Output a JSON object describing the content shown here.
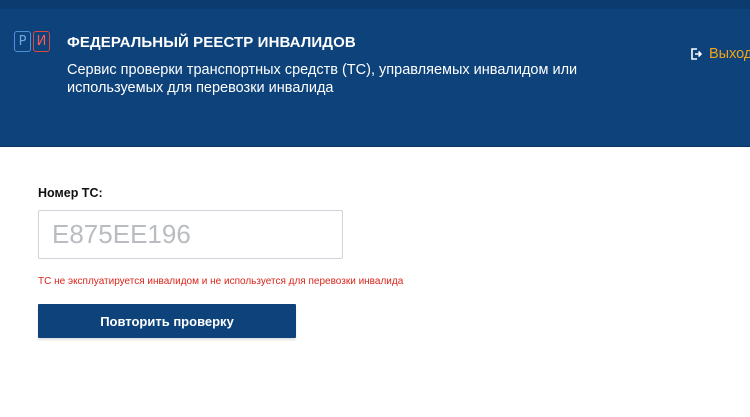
{
  "header": {
    "logo": {
      "left_letter": "Р",
      "right_letter": "И"
    },
    "title": "ФЕДЕРАЛЬНЫЙ РЕЕСТР ИНВАЛИДОВ",
    "subtitle": "Сервис проверки транспортных средств (ТС), управляемых инвалидом или используемых для перевозки инвалида",
    "logout_label": "Выход",
    "logout_icon": "logout-icon"
  },
  "form": {
    "vehicle_number_label": "Номер ТС:",
    "vehicle_number_value": "Е875ЕЕ196",
    "result_message": "ТС не эксплуатируется инвалидом и не используется для перевозки инвалида",
    "retry_button_label": "Повторить проверку"
  },
  "colors": {
    "header_bg": "#0d427b",
    "logout_accent": "#f2a516",
    "error": "#d9261c",
    "button_bg": "#0d427b"
  }
}
